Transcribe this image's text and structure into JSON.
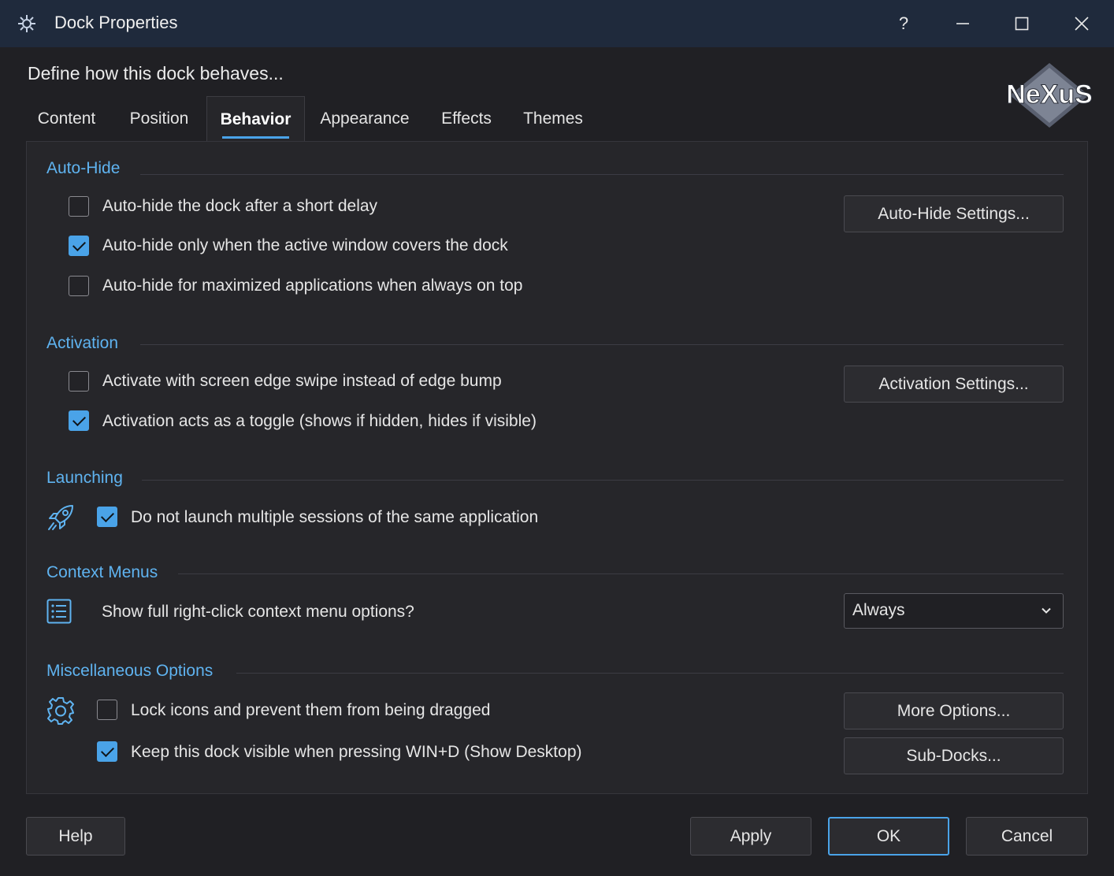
{
  "window": {
    "title": "Dock Properties",
    "help_glyph": "?",
    "accent": "#4aa3e8"
  },
  "header": {
    "subtitle": "Define how this dock behaves...",
    "logo_text": "NeXuS"
  },
  "tabs": [
    {
      "label": "Content"
    },
    {
      "label": "Position"
    },
    {
      "label": "Behavior",
      "active": true
    },
    {
      "label": "Appearance"
    },
    {
      "label": "Effects"
    },
    {
      "label": "Themes"
    }
  ],
  "sections": {
    "autohide": {
      "title": "Auto-Hide",
      "options": [
        {
          "label": "Auto-hide the dock after a short delay",
          "checked": false
        },
        {
          "label": "Auto-hide only when the active window covers the dock",
          "checked": true
        },
        {
          "label": "Auto-hide for maximized applications when always on top",
          "checked": false
        }
      ],
      "button": "Auto-Hide Settings..."
    },
    "activation": {
      "title": "Activation",
      "options": [
        {
          "label": "Activate with screen edge swipe instead of edge bump",
          "checked": false
        },
        {
          "label": "Activation acts as a toggle (shows if hidden, hides if visible)",
          "checked": true
        }
      ],
      "button": "Activation Settings..."
    },
    "launching": {
      "title": "Launching",
      "icon": "rocket-icon",
      "options": [
        {
          "label": "Do not launch multiple sessions of the same application",
          "checked": true
        }
      ]
    },
    "context": {
      "title": "Context Menus",
      "icon": "list-icon",
      "label": "Show full right-click context menu options?",
      "select_value": "Always"
    },
    "misc": {
      "title": "Miscellaneous Options",
      "icon": "gear-icon",
      "options": [
        {
          "label": "Lock icons and prevent them from being dragged",
          "checked": false
        },
        {
          "label": "Keep this dock visible when pressing WIN+D (Show Desktop)",
          "checked": true
        }
      ],
      "buttons": [
        "More Options...",
        "Sub-Docks..."
      ]
    }
  },
  "footer": {
    "help": "Help",
    "apply": "Apply",
    "ok": "OK",
    "cancel": "Cancel"
  }
}
